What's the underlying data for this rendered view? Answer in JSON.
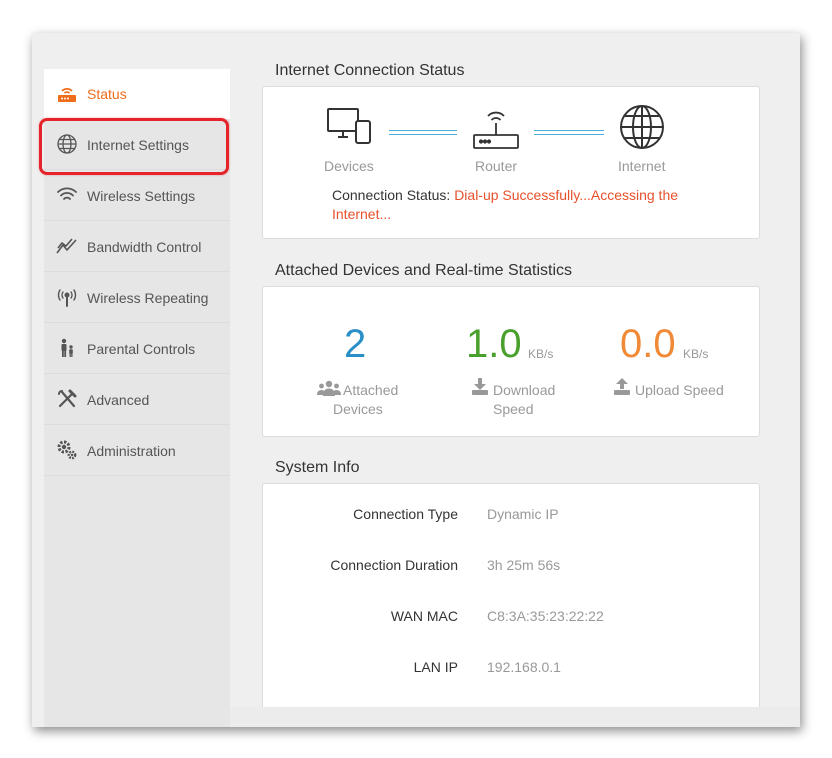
{
  "sidebar": {
    "items": [
      {
        "id": "status",
        "label": "Status",
        "icon": "router-status-icon",
        "active": true
      },
      {
        "id": "internet-settings",
        "label": "Internet Settings",
        "icon": "globe-icon",
        "active": false
      },
      {
        "id": "wireless-settings",
        "label": "Wireless Settings",
        "icon": "wifi-icon",
        "active": false
      },
      {
        "id": "bandwidth-control",
        "label": "Bandwidth Control",
        "icon": "bandwidth-icon",
        "active": false
      },
      {
        "id": "wireless-repeating",
        "label": "Wireless Repeating",
        "icon": "antenna-icon",
        "active": false
      },
      {
        "id": "parental-controls",
        "label": "Parental Controls",
        "icon": "family-icon",
        "active": false
      },
      {
        "id": "advanced",
        "label": "Advanced",
        "icon": "tools-icon",
        "active": false
      },
      {
        "id": "administration",
        "label": "Administration",
        "icon": "gears-icon",
        "active": false
      }
    ]
  },
  "connection_status": {
    "title": "Internet Connection Status",
    "devices_label": "Devices",
    "router_label": "Router",
    "internet_label": "Internet",
    "status_key": "Connection Status:",
    "status_value": "Dial-up Successfully...Accessing the Internet..."
  },
  "statistics": {
    "title": "Attached Devices and Real-time Statistics",
    "attached_count": "2",
    "attached_label_1": "Attached",
    "attached_label_2": "Devices",
    "download_value": "1.0",
    "download_unit": "KB/s",
    "download_label_1": "Download",
    "download_label_2": "Speed",
    "upload_value": "0.0",
    "upload_unit": "KB/s",
    "upload_label": "Upload Speed"
  },
  "system_info": {
    "title": "System Info",
    "rows": [
      {
        "key": "Connection Type",
        "value": "Dynamic IP"
      },
      {
        "key": "Connection Duration",
        "value": "3h 25m 56s"
      },
      {
        "key": "WAN MAC",
        "value": "C8:3A:35:23:22:22"
      },
      {
        "key": "LAN IP",
        "value": "192.168.0.1"
      }
    ]
  },
  "colors": {
    "accent_orange": "#ef6c1a",
    "status_red": "#e8502c",
    "attached_blue": "#2b8fc7",
    "download_green": "#4aa02c",
    "upload_orange": "#f08a36",
    "link_blue": "#4ab0d8",
    "highlight_red": "#e4242a"
  }
}
